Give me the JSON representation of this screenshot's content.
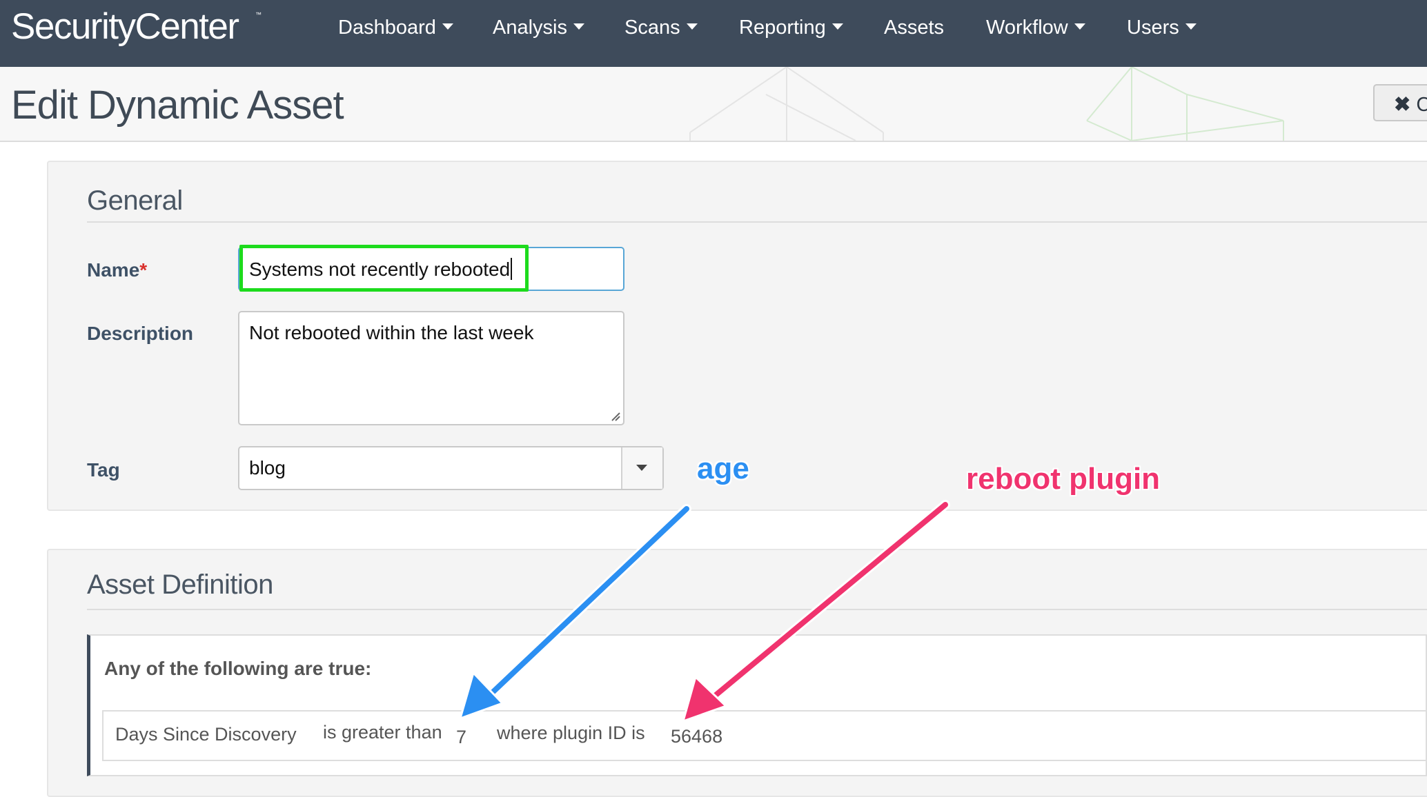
{
  "app": {
    "brand": "SecurityCenter",
    "trademark": "™"
  },
  "nav": {
    "items": [
      {
        "label": "Dashboard",
        "has_caret": true
      },
      {
        "label": "Analysis",
        "has_caret": true
      },
      {
        "label": "Scans",
        "has_caret": true
      },
      {
        "label": "Reporting",
        "has_caret": true
      },
      {
        "label": "Assets",
        "has_caret": false
      },
      {
        "label": "Workflow",
        "has_caret": true
      },
      {
        "label": "Users",
        "has_caret": true
      }
    ]
  },
  "header": {
    "title": "Edit Dynamic Asset",
    "close_button": {
      "icon": "close-icon",
      "label": "C"
    }
  },
  "general": {
    "title": "General",
    "name_label": "Name",
    "required_marker": "*",
    "name_value": "Systems not recently rebooted",
    "description_label": "Description",
    "description_value": "Not rebooted within the last week",
    "tag_label": "Tag",
    "tag_value": "blog"
  },
  "asset_definition": {
    "title": "Asset Definition",
    "group_label": "Any of the following are true:",
    "condition": {
      "field": "Days Since Discovery",
      "operator": "is greater than",
      "value": "7",
      "filter_text": "where plugin ID is",
      "plugin_id": "56468"
    }
  },
  "annotations": {
    "age": {
      "text": "age",
      "color": "#2b8ff2"
    },
    "reboot_plugin": {
      "text": "reboot plugin",
      "color": "#f0336e"
    }
  },
  "colors": {
    "nav_bg": "#3e4b5b",
    "label": "#3e5166",
    "input_focus_border": "#58a6d6",
    "highlight": "#1ddb1d"
  }
}
